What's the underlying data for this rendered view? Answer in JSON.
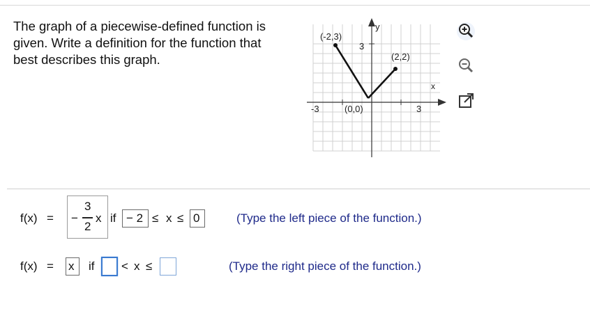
{
  "question": {
    "lines": [
      "The graph of a piecewise-defined function is",
      "given.  Write a definition for the function that",
      "best describes this graph."
    ]
  },
  "graph": {
    "y_axis_label": "y",
    "x_axis_label": "x",
    "tick_x_neg": "-3",
    "tick_x_pos": "3",
    "tick_y_pos": "3",
    "point_left_label": "(-2,3)",
    "point_origin_label": "(0,0)",
    "point_right_label": "(2,2)",
    "points": [
      [
        -2,
        3
      ],
      [
        0,
        0
      ],
      [
        2,
        2
      ]
    ],
    "x_range": [
      -4,
      4
    ],
    "y_range": [
      -4,
      4
    ]
  },
  "tools": {
    "zoom_in": "zoom-in-icon",
    "zoom_out": "zoom-out-icon",
    "popout": "popout-icon"
  },
  "row1": {
    "fx": "f(x)",
    "eq": "=",
    "minus": "−",
    "num": "3",
    "den": "2",
    "var": "x",
    "if": "if",
    "lower": "− 2",
    "le1": "≤",
    "x": "x",
    "le2": "≤",
    "upper": "0",
    "hint": "(Type the left piece of the function.)"
  },
  "row2": {
    "fx": "f(x)",
    "eq": "=",
    "expr": "x",
    "if": "if",
    "lower": "",
    "lt": "<",
    "x": "x",
    "le": "≤",
    "upper": "",
    "hint": "(Type the right piece of the function.)"
  }
}
